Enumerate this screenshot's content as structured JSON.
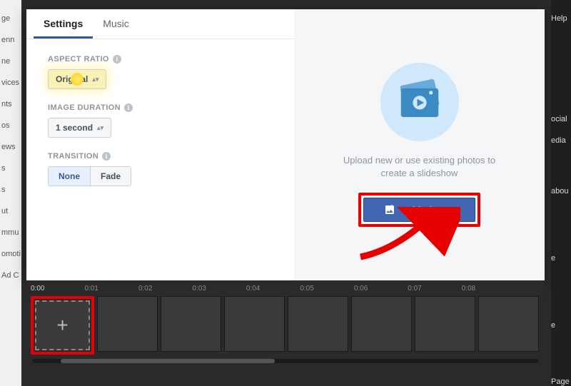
{
  "tabs": {
    "settings": "Settings",
    "music": "Music"
  },
  "fields": {
    "aspect": {
      "label": "ASPECT RATIO",
      "value": "Original"
    },
    "duration": {
      "label": "IMAGE DURATION",
      "value": "1 second"
    },
    "transition": {
      "label": "TRANSITION",
      "none": "None",
      "fade": "Fade"
    }
  },
  "right": {
    "hint": "Upload new or use existing photos to create a slideshow",
    "button": "Add Photos"
  },
  "ruler": [
    "0:00",
    "0:01",
    "0:02",
    "0:03",
    "0:04",
    "0:05",
    "0:06",
    "0:07",
    "0:08"
  ],
  "bg_left": [
    "ge",
    "enn",
    "ne",
    "vices",
    "nts",
    "os",
    "ews",
    "s",
    "s",
    "ut",
    "mmu",
    "omoti",
    "Ad C"
  ],
  "bg_right": [
    "Help",
    "ocial",
    "edia",
    "abou",
    "e",
    "e",
    "Page"
  ]
}
